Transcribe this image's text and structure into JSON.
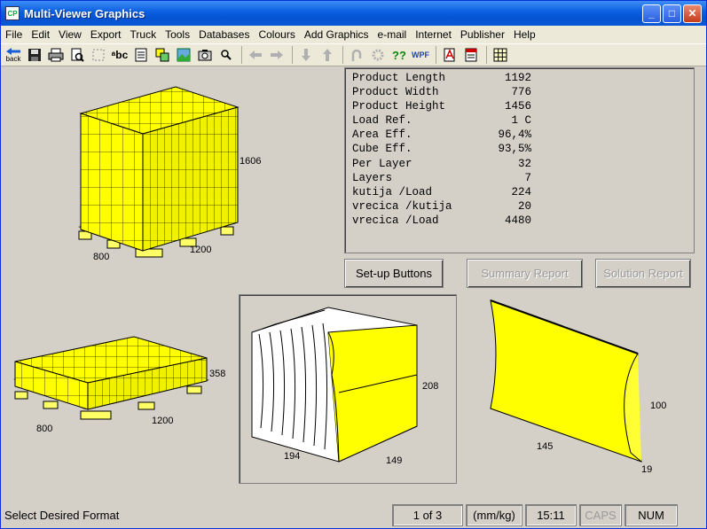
{
  "window": {
    "title": "Multi-Viewer Graphics",
    "app_icon_text": "CP",
    "minimize_label": "_",
    "maximize_label": "□",
    "close_label": "✕"
  },
  "menu": [
    "File",
    "Edit",
    "View",
    "Export",
    "Truck",
    "Tools",
    "Databases",
    "Colours",
    "Add Graphics",
    "e-mail",
    "Internet",
    "Publisher",
    "Help"
  ],
  "toolbar": {
    "back_label": "back",
    "abc_label": "ᵃbc",
    "help_label": "??",
    "wpf_label": "WPF"
  },
  "info": [
    {
      "label": "Product Length",
      "value": "1192"
    },
    {
      "label": "Product Width",
      "value": "776"
    },
    {
      "label": "Product Height",
      "value": "1456"
    },
    {
      "label": "Load Ref.",
      "value": "1 C"
    },
    {
      "label": "Area Eff.",
      "value": "96,4%"
    },
    {
      "label": "Cube Eff.",
      "value": "93,5%"
    },
    {
      "label": "Per Layer",
      "value": "32"
    },
    {
      "label": "Layers",
      "value": "7"
    },
    {
      "label": "kutija /Load",
      "value": "224"
    },
    {
      "label": "vrecica /kutija",
      "value": "20"
    },
    {
      "label": "vrecica /Load",
      "value": "4480"
    }
  ],
  "buttons": {
    "setup": "Set-up Buttons",
    "summary": "Summary Report",
    "solution": "Solution Report"
  },
  "pallet_full": {
    "height": "1606",
    "depth": "800",
    "length": "1200"
  },
  "pallet_layer": {
    "height": "358",
    "depth": "800",
    "length": "1200"
  },
  "case_view": {
    "height": "208",
    "length": "194",
    "width": "149"
  },
  "bag_view": {
    "height": "100",
    "length": "145",
    "thickness": "19"
  },
  "status": {
    "message": "Select Desired Format",
    "page": "1 of 3",
    "units": "(mm/kg)",
    "time": "15:11",
    "caps": "CAPS",
    "num": "NUM"
  }
}
